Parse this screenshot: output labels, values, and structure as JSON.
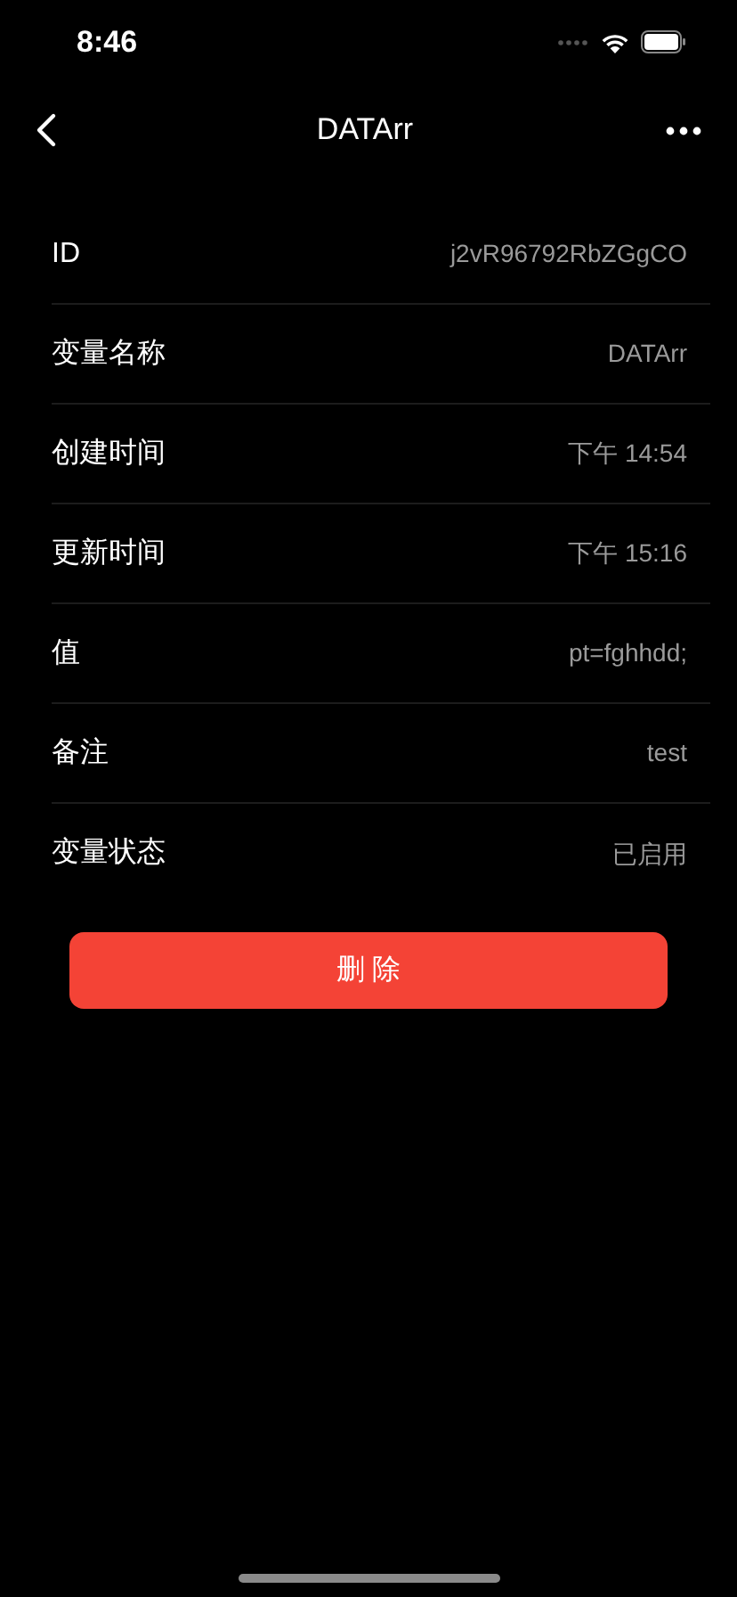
{
  "status_bar": {
    "time": "8:46"
  },
  "nav": {
    "title": "DATArr"
  },
  "rows": [
    {
      "label": "ID",
      "value": "j2vR96792RbZGgCO"
    },
    {
      "label": "变量名称",
      "value": "DATArr"
    },
    {
      "label": "创建时间",
      "value": "下午 14:54"
    },
    {
      "label": "更新时间",
      "value": "下午 15:16"
    },
    {
      "label": "值",
      "value": "pt=fghhdd;"
    },
    {
      "label": "备注",
      "value": "test"
    },
    {
      "label": "变量状态",
      "value": "已启用"
    }
  ],
  "delete_button": "删 除"
}
